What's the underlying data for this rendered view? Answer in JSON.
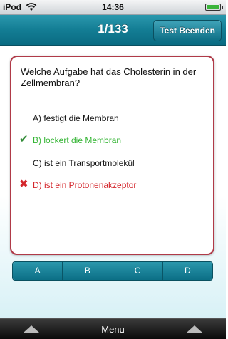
{
  "status": {
    "carrier": "iPod",
    "time": "14:36"
  },
  "nav": {
    "counter": "1/133",
    "end_button": "Test Beenden"
  },
  "question": {
    "text": "Welche Aufgabe hat das Cholesterin in der Zellmembran?",
    "answers": [
      {
        "label": "A) festigt die Membran",
        "state": "neutral"
      },
      {
        "label": "B) lockert die Membran",
        "state": "correct"
      },
      {
        "label": "C) ist ein Transportmolekül",
        "state": "neutral"
      },
      {
        "label": "D) ist ein Protonenakzeptor",
        "state": "wrong"
      }
    ]
  },
  "options": [
    "A",
    "B",
    "C",
    "D"
  ],
  "bottom": {
    "menu_label": "Menu"
  },
  "colors": {
    "nav": "#137d94",
    "card_border": "#b03a48",
    "correct": "#33b433",
    "wrong": "#d4262c"
  }
}
